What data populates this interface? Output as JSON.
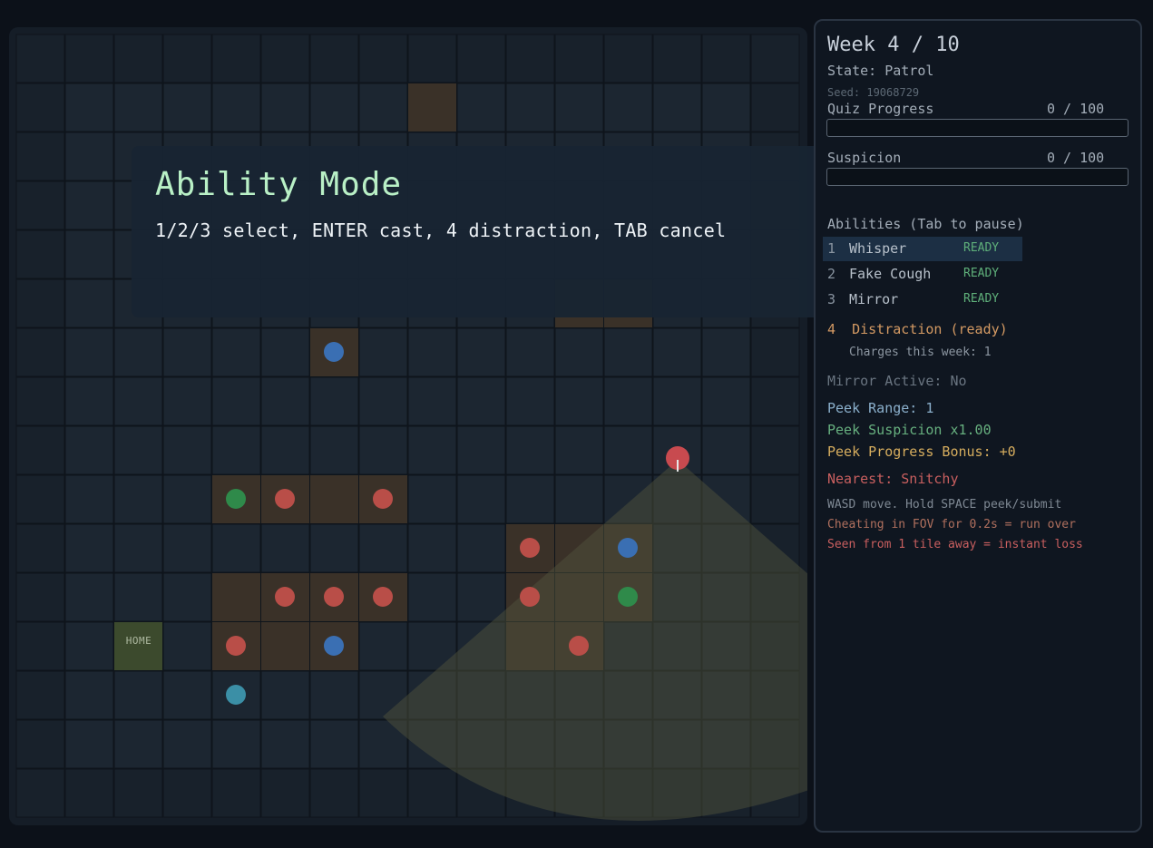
{
  "board": {
    "home_label": "HOME",
    "colors": {
      "background": "#151d27",
      "floor": "#1c2631",
      "grid_line": "#0e141b",
      "desk": "#3a3128",
      "home": "#3c4a2d",
      "student_red": "#b94e48",
      "student_blue": "#3a6fb3",
      "student_green": "#2f8a4a",
      "player": "#3b8fa6",
      "teacher": "#c84a4f",
      "fov": "#55573f"
    }
  },
  "overlay": {
    "title": "Ability Mode",
    "hint": "1/2/3 select, ENTER cast, 4 distraction, TAB cancel"
  },
  "panel": {
    "week": "Week 4 / 10",
    "state": "State: Patrol",
    "seed": "Seed: 19068729",
    "quiz": {
      "label": "Quiz Progress",
      "value_text": "0 / 100",
      "value": 0,
      "max": 100
    },
    "suspicion": {
      "label": "Suspicion",
      "value_text": "0 / 100",
      "value": 0,
      "max": 100
    },
    "abilities_header": "Abilities (Tab to pause)",
    "abilities": [
      {
        "key": "1",
        "name": "Whisper",
        "status": "READY"
      },
      {
        "key": "2",
        "name": "Fake Cough",
        "status": "READY"
      },
      {
        "key": "3",
        "name": "Mirror",
        "status": "READY"
      }
    ],
    "distraction": "4  Distraction (ready)",
    "charges": "Charges this week: 1",
    "mirror_active": "Mirror Active: No",
    "peek_range": "Peek Range: 1",
    "peek_suspicion": "Peek Suspicion x1.00",
    "peek_progress": "Peek Progress Bonus: +0",
    "nearest": "Nearest: Snitchy",
    "help_move": "WASD move. Hold SPACE peek/submit",
    "help_fov": "Cheating in FOV for 0.2s = run over",
    "help_loss": "Seen from 1 tile away = instant loss"
  }
}
